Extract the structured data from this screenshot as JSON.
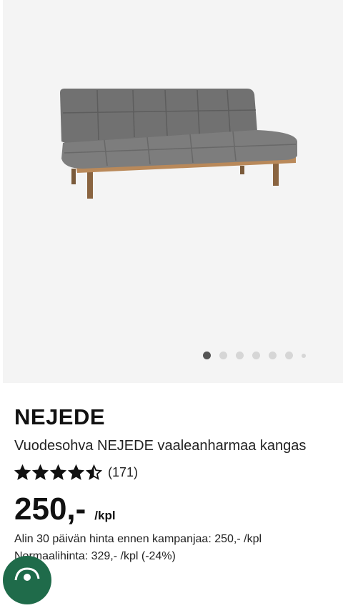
{
  "gallery": {
    "image_alt": "Vuodesohva NEJEDE vaaleanharmaa kangas",
    "dots": [
      {
        "active": true
      },
      {
        "active": false
      },
      {
        "active": false
      },
      {
        "active": false
      },
      {
        "active": false
      },
      {
        "active": false
      },
      {
        "active": false,
        "small": true
      }
    ]
  },
  "product": {
    "name": "NEJEDE",
    "description": "Vuodesohva NEJEDE vaaleanharmaa kangas",
    "rating": 4.5,
    "rating_max": 5,
    "review_count": "(171)",
    "price": "250,-",
    "price_unit": "/kpl",
    "lowest_price_text": "Alin 30 päivän hinta ennen kampanjaa: 250,- /kpl",
    "normal_price_text": "Normaalihinta: 329,- /kpl (-24%)"
  },
  "chat_button": {
    "icon": "chat-icon"
  },
  "colors": {
    "gallery_bg": "#f4f4f4",
    "chat": "#1f6b4a",
    "dot_active": "#555555",
    "dot_inactive": "#d6d6d6"
  }
}
